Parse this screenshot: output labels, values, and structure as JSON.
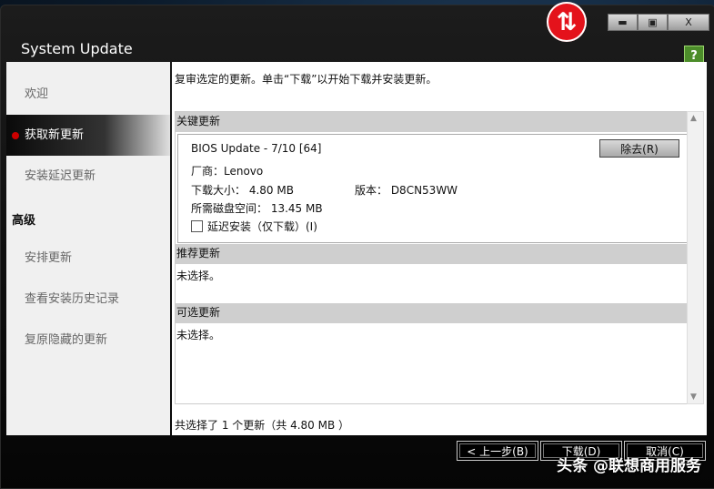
{
  "window": {
    "title": "System Update",
    "minimize": "▬",
    "maximize": "▣",
    "close": "X",
    "help": "?",
    "badge": "⇅"
  },
  "sidebar": {
    "items": [
      {
        "label": "欢迎"
      },
      {
        "label": "获取新更新"
      },
      {
        "label": "安装延迟更新"
      }
    ],
    "advanced_header": "高级",
    "advanced_items": [
      {
        "label": "安排更新"
      },
      {
        "label": "查看安装历史记录"
      },
      {
        "label": "复原隐藏的更新"
      }
    ]
  },
  "content": {
    "instruction": "复审选定的更新。单击“下载”以开始下载并安装更新。",
    "critical": {
      "header": "关键更新",
      "update": {
        "title": "BIOS Update - 7/10 [64]",
        "remove_label": "除去(R)",
        "vendor": "厂商：Lenovo",
        "size": "下载大小：  4.80 MB",
        "version": "版本：  D8CN53WW",
        "disk": "所需磁盘空间：  13.45 MB",
        "defer": "延迟安装（仅下载）(I)"
      }
    },
    "recommended": {
      "header": "推荐更新",
      "empty": "未选择。"
    },
    "optional": {
      "header": "可选更新",
      "empty": "未选择。"
    },
    "summary": "共选择了 1 个更新（共  4.80 MB ）"
  },
  "footer": {
    "back": "< 上一步(B)",
    "download": "下载(D)",
    "cancel": "取消(C)"
  },
  "watermark": "头条 @联想商用服务"
}
